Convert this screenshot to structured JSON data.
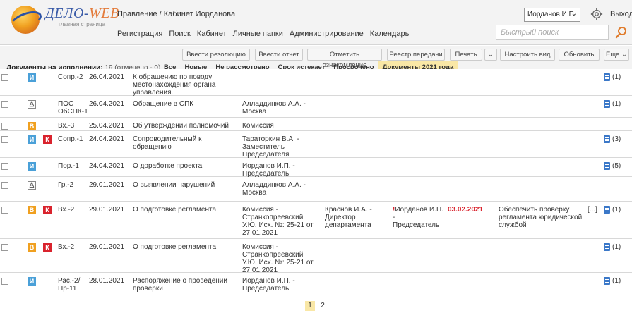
{
  "header": {
    "logo_text_a": "ДЕЛО-",
    "logo_text_b": "WEB",
    "logo_sub": "главная страница",
    "breadcrumb": "Правление / Кабинет Иорданова",
    "menu": [
      "Регистрация",
      "Поиск",
      "Кабинет",
      "Личные папки",
      "Администрирование",
      "Календарь"
    ],
    "user": "Иорданов И.П.",
    "exit": "Выход",
    "search_placeholder": "Быстрый поиск"
  },
  "toolbar": {
    "buttons": [
      "Ввести резолюцию",
      "Ввести отчет",
      "Отметить ознакомление",
      "Реестр передачи",
      "Печать",
      "Настроить вид",
      "Обновить",
      "Еще"
    ],
    "docs_label": "Документы на исполнении:",
    "docs_count": "19 (отмечено - 0)",
    "filters": [
      "Все",
      "Новые",
      "Не рассмотрено",
      "Срок истекает",
      "Просрочено",
      "Документы 2021 года"
    ],
    "active_filter": "Документы 2021 года"
  },
  "rows": [
    {
      "icons": [
        "i"
      ],
      "num": "Сопр.-2",
      "date": "26.04.2021",
      "title": "К обращению по поводу местонахождения органа управления.",
      "author": "",
      "exec": "",
      "ctrl": "",
      "due": "",
      "res": "",
      "dots": "",
      "docs": "(1)"
    },
    {
      "icons": [
        "person"
      ],
      "num": "ПОС ОбСПК-1",
      "date": "26.04.2021",
      "title": "Обращение в СПК",
      "author": "Алладдинков А.А. - Москва",
      "exec": "",
      "ctrl": "",
      "due": "",
      "res": "",
      "dots": "",
      "docs": "(1)"
    },
    {
      "icons": [
        "v"
      ],
      "num": "Вх.-3",
      "date": "25.04.2021",
      "title": "Об утверждении полномочий",
      "author": "Комиссия",
      "exec": "",
      "ctrl": "",
      "due": "",
      "res": "",
      "dots": "",
      "docs": ""
    },
    {
      "icons": [
        "i",
        "k"
      ],
      "num": "Сопр.-1",
      "date": "24.04.2021",
      "title": "Сопроводительный к обращению",
      "author": "Тараторкин В.А. - Заместитель Председателя",
      "exec": "",
      "ctrl": "",
      "due": "",
      "res": "",
      "dots": "",
      "docs": "(3)"
    },
    {
      "icons": [
        "i"
      ],
      "num": "Пор.-1",
      "date": "24.04.2021",
      "title": "О доработке проекта",
      "author": "Иорданов И.П. - Председатель",
      "exec": "",
      "ctrl": "",
      "due": "",
      "res": "",
      "dots": "",
      "docs": "(5)"
    },
    {
      "icons": [
        "person"
      ],
      "num": "Гр.-2",
      "date": "29.01.2021",
      "title": "О выявлении нарушений",
      "author": "Алладдинков А.А. - Москва",
      "exec": "",
      "ctrl": "",
      "due": "",
      "res": "",
      "dots": "",
      "docs": ""
    },
    {
      "icons": [
        "v",
        "k"
      ],
      "num": "Вх.-2",
      "date": "29.01.2021",
      "title": "О подготовке регламента",
      "author": "Комиссия - Странкопреевский У.Ю. Исх. №: 25-21 от 27.01.2021",
      "exec": "Краснов И.А. - Директор департамента",
      "ctrl": "Иорданов И.П. - Председатель",
      "ctrl_mark": "!",
      "due": "03.02.2021",
      "res": "Обеспечить проверку регламента юридической службой",
      "dots": "[...]",
      "docs": "(1)"
    },
    {
      "icons": [
        "v",
        "k"
      ],
      "num": "Вх.-2",
      "date": "29.01.2021",
      "title": "О подготовке регламента",
      "author": "Комиссия - Странкопреевский У.Ю. Исх. №: 25-21 от 27.01.2021",
      "exec": "",
      "ctrl": "",
      "due": "",
      "res": "",
      "dots": "",
      "docs": "(1)"
    },
    {
      "icons": [
        "i"
      ],
      "num": "Рас.-2/ Пр-11",
      "date": "28.01.2021",
      "title": "Распоряжение о проведении проверки",
      "author": "Иорданов И.П. - Председатель",
      "exec": "",
      "ctrl": "",
      "due": "",
      "res": "",
      "dots": "",
      "docs": "(1)"
    }
  ],
  "pager": {
    "pages": [
      "1",
      "2"
    ],
    "active": "1"
  },
  "icon_letters": {
    "i": "И",
    "v": "В",
    "k": "К",
    "person": "♙"
  },
  "colors": {
    "active_filter_bg": "#f9e7a6",
    "due_red": "#d9232d",
    "icon_blue": "#4aa0d8",
    "icon_orange": "#f0a020",
    "icon_red": "#d9232d"
  }
}
